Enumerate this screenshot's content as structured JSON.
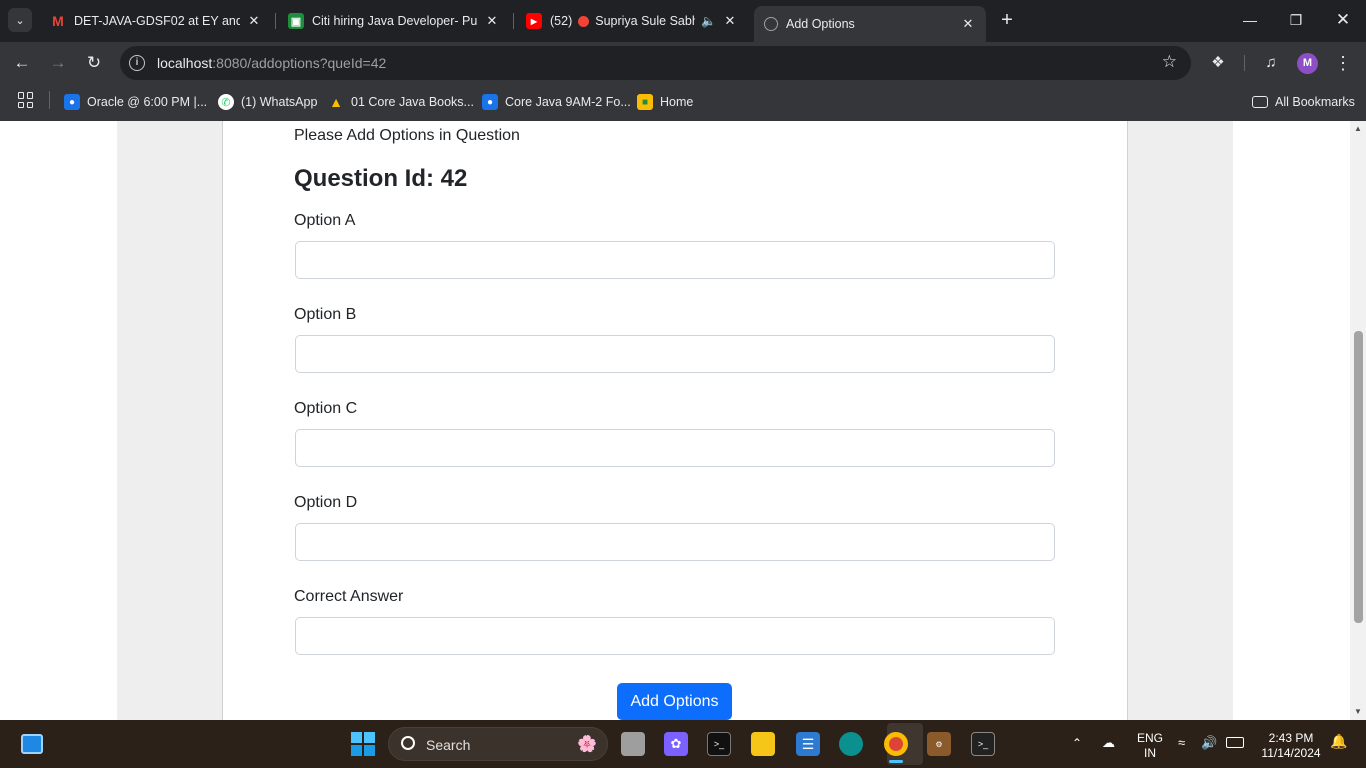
{
  "tabs": [
    {
      "title": "DET-JAVA-GDSF02 at EY and 9",
      "favicon": "gmail-icon"
    },
    {
      "title": "Citi hiring Java Developer- Pune",
      "favicon": "jobs-icon"
    },
    {
      "title": "(52)",
      "recording_label": "Supriya Sule Sabha",
      "favicon": "youtube-icon",
      "audio": true
    },
    {
      "title": "Add Options",
      "favicon": "globe-icon",
      "active": true
    }
  ],
  "address": {
    "host": "localhost",
    "rest": ":8080/addoptions?queId=42"
  },
  "profile_initial": "M",
  "bookmarks": [
    {
      "label": "Oracle @ 6:00 PM |...",
      "icon": "person-badge-icon"
    },
    {
      "label": "(1) WhatsApp",
      "icon": "whatsapp-icon"
    },
    {
      "label": "01 Core Java Books...",
      "icon": "drive-icon"
    },
    {
      "label": "Core Java 9AM-2 Fo...",
      "icon": "person-badge-icon"
    },
    {
      "label": "Home",
      "icon": "classroom-icon"
    }
  ],
  "all_bookmarks_label": "All Bookmarks",
  "page": {
    "intro": "Please Add Options in Question",
    "question_heading": "Question Id: 42",
    "fields": [
      {
        "label": "Option A",
        "value": ""
      },
      {
        "label": "Option B",
        "value": ""
      },
      {
        "label": "Option C",
        "value": ""
      },
      {
        "label": "Option D",
        "value": ""
      },
      {
        "label": "Correct Answer",
        "value": ""
      }
    ],
    "submit_label": "Add Options"
  },
  "taskbar": {
    "search_label": "Search",
    "language": "ENG",
    "region": "IN",
    "time": "2:43 PM",
    "date": "11/14/2024"
  },
  "colors": {
    "primary_button": "#0d6efd",
    "chrome_dark": "#202124",
    "chrome_toolbar": "#35363a"
  }
}
